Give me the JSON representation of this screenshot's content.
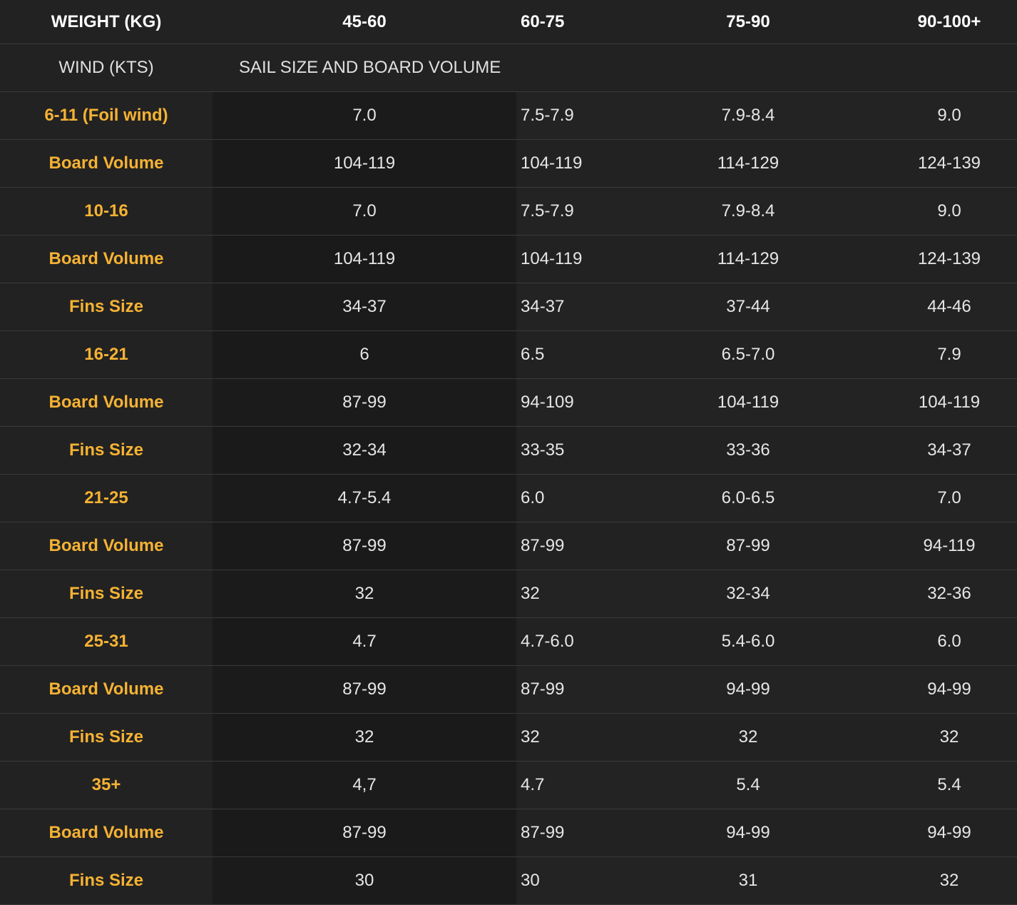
{
  "colors": {
    "background": "#1e1e1e",
    "header_text": "#ffffff",
    "label_accent": "#f6b233",
    "cell_text": "#e6e6e6",
    "divider": "#3a3a3a"
  },
  "header": {
    "label": "WEIGHT (KG)",
    "columns": [
      "45-60",
      "60-75",
      "75-90",
      "90-100+"
    ]
  },
  "subheader": {
    "label": "WIND (KTS)",
    "caption": "SAIL SIZE AND BOARD VOLUME"
  },
  "rows": [
    {
      "label": "6-11 (Foil wind)",
      "cells": [
        "7.0",
        "7.5-7.9",
        "7.9-8.4",
        "9.0"
      ]
    },
    {
      "label": "Board Volume",
      "cells": [
        "104-119",
        "104-119",
        "114-129",
        "124-139"
      ]
    },
    {
      "label": "10-16",
      "cells": [
        "7.0",
        "7.5-7.9",
        "7.9-8.4",
        "9.0"
      ]
    },
    {
      "label": "Board Volume",
      "cells": [
        "104-119",
        "104-119",
        "114-129",
        "124-139"
      ]
    },
    {
      "label": "Fins Size",
      "cells": [
        "34-37",
        "34-37",
        "37-44",
        "44-46"
      ]
    },
    {
      "label": "16-21",
      "cells": [
        "6",
        "6.5",
        "6.5-7.0",
        "7.9"
      ]
    },
    {
      "label": "Board Volume",
      "cells": [
        "87-99",
        "94-109",
        "104-119",
        "104-119"
      ]
    },
    {
      "label": "Fins Size",
      "cells": [
        "32-34",
        "33-35",
        "33-36",
        "34-37"
      ]
    },
    {
      "label": "21-25",
      "cells": [
        "4.7-5.4",
        "6.0",
        "6.0-6.5",
        "7.0"
      ]
    },
    {
      "label": "Board Volume",
      "cells": [
        "87-99",
        "87-99",
        "87-99",
        "94-119"
      ]
    },
    {
      "label": "Fins Size",
      "cells": [
        "32",
        "32",
        "32-34",
        "32-36"
      ]
    },
    {
      "label": "25-31",
      "cells": [
        "4.7",
        "4.7-6.0",
        "5.4-6.0",
        "6.0"
      ]
    },
    {
      "label": "Board Volume",
      "cells": [
        "87-99",
        "87-99",
        "94-99",
        "94-99"
      ]
    },
    {
      "label": "Fins Size",
      "cells": [
        "32",
        "32",
        "32",
        "32"
      ]
    },
    {
      "label": "35+",
      "cells": [
        "4,7",
        "4.7",
        "5.4",
        "5.4"
      ]
    },
    {
      "label": "Board Volume",
      "cells": [
        "87-99",
        "87-99",
        "94-99",
        "94-99"
      ]
    },
    {
      "label": "Fins Size",
      "cells": [
        "30",
        "30",
        "31",
        "32"
      ]
    }
  ]
}
